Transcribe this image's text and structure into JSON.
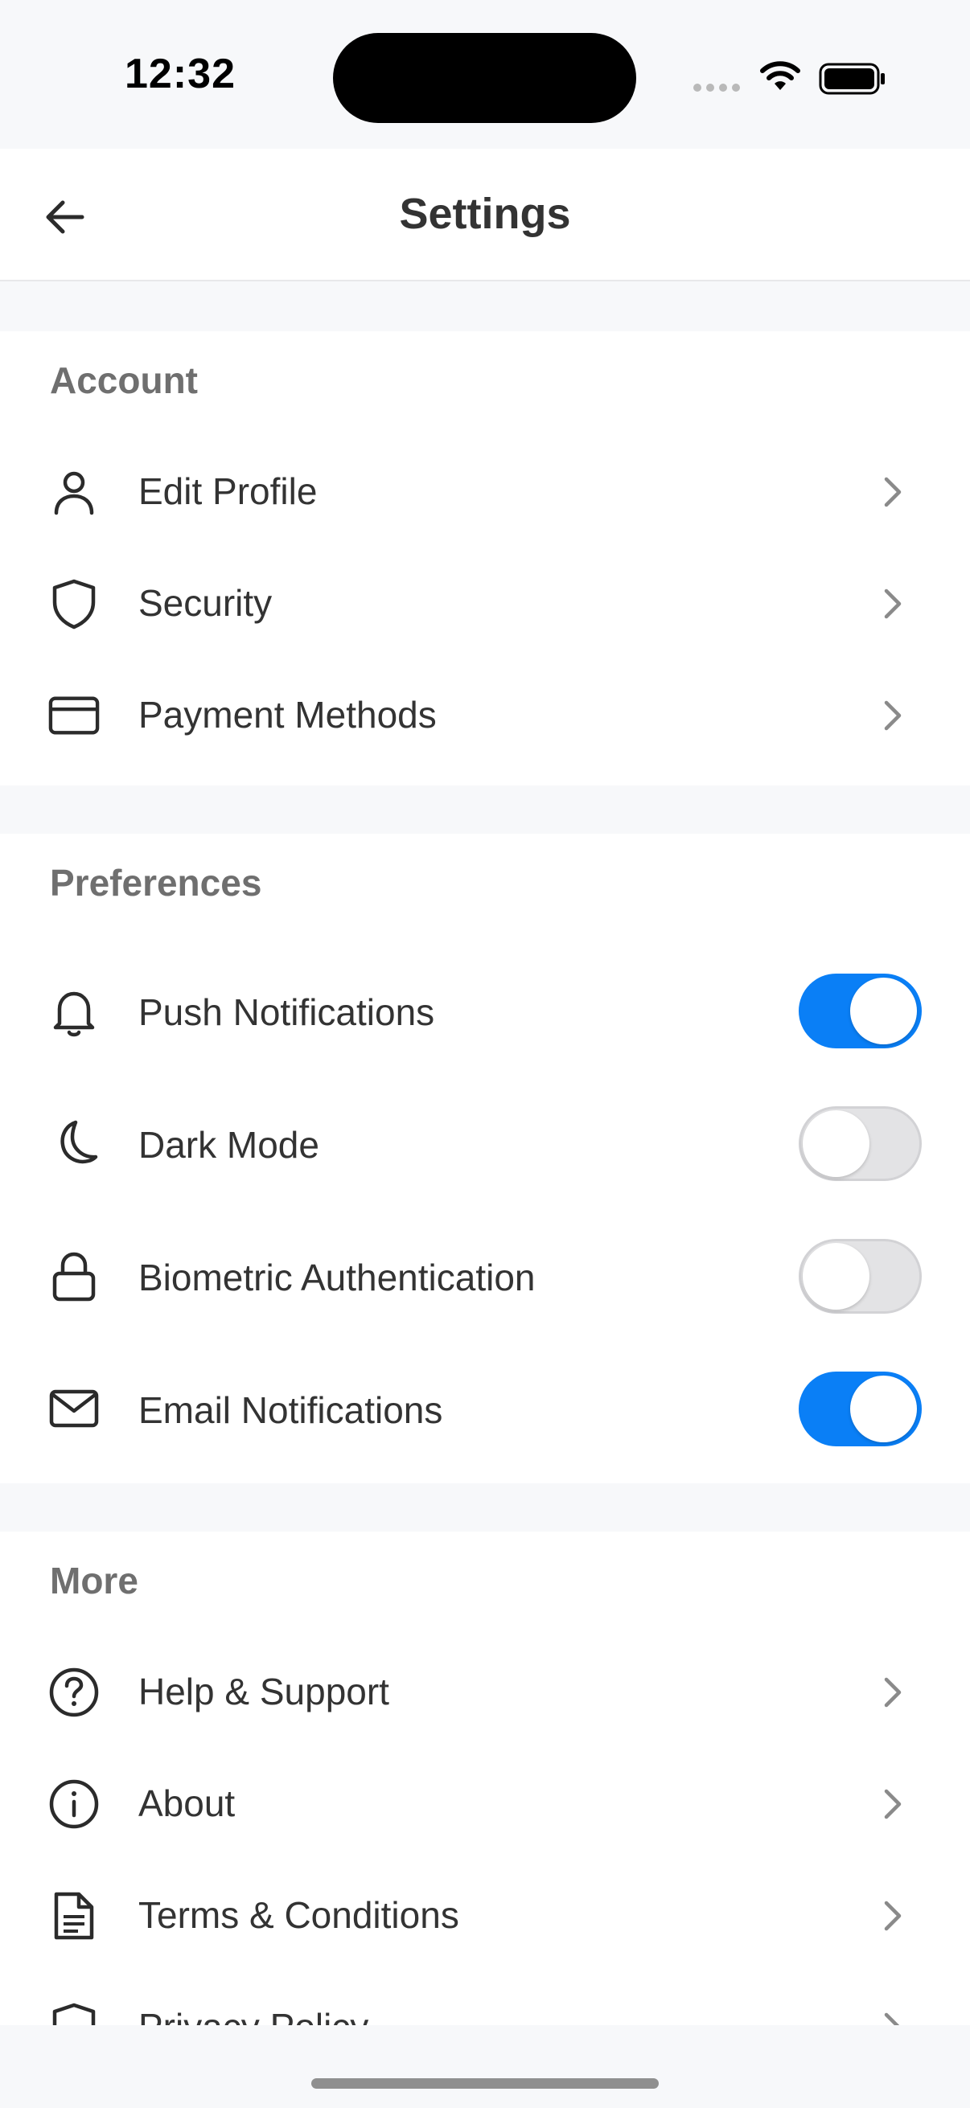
{
  "status_bar": {
    "time": "12:32"
  },
  "header": {
    "title": "Settings"
  },
  "sections": {
    "account": {
      "title": "Account",
      "items": [
        {
          "label": "Edit Profile",
          "icon": "user-icon"
        },
        {
          "label": "Security",
          "icon": "shield-icon"
        },
        {
          "label": "Payment Methods",
          "icon": "credit-card-icon"
        }
      ]
    },
    "preferences": {
      "title": "Preferences",
      "items": [
        {
          "label": "Push Notifications",
          "icon": "bell-icon",
          "enabled": true
        },
        {
          "label": "Dark Mode",
          "icon": "moon-icon",
          "enabled": false
        },
        {
          "label": "Biometric Authentication",
          "icon": "lock-icon",
          "enabled": false
        },
        {
          "label": "Email Notifications",
          "icon": "mail-icon",
          "enabled": true
        }
      ]
    },
    "more": {
      "title": "More",
      "items": [
        {
          "label": "Help & Support",
          "icon": "help-circle-icon"
        },
        {
          "label": "About",
          "icon": "info-icon"
        },
        {
          "label": "Terms & Conditions",
          "icon": "document-icon"
        },
        {
          "label": "Privacy Policy",
          "icon": "shield-icon"
        }
      ]
    }
  },
  "colors": {
    "accent": "#0A7FF6",
    "background": "#F7F8FA",
    "section_title": "#6F6F6F",
    "text": "#333333"
  }
}
